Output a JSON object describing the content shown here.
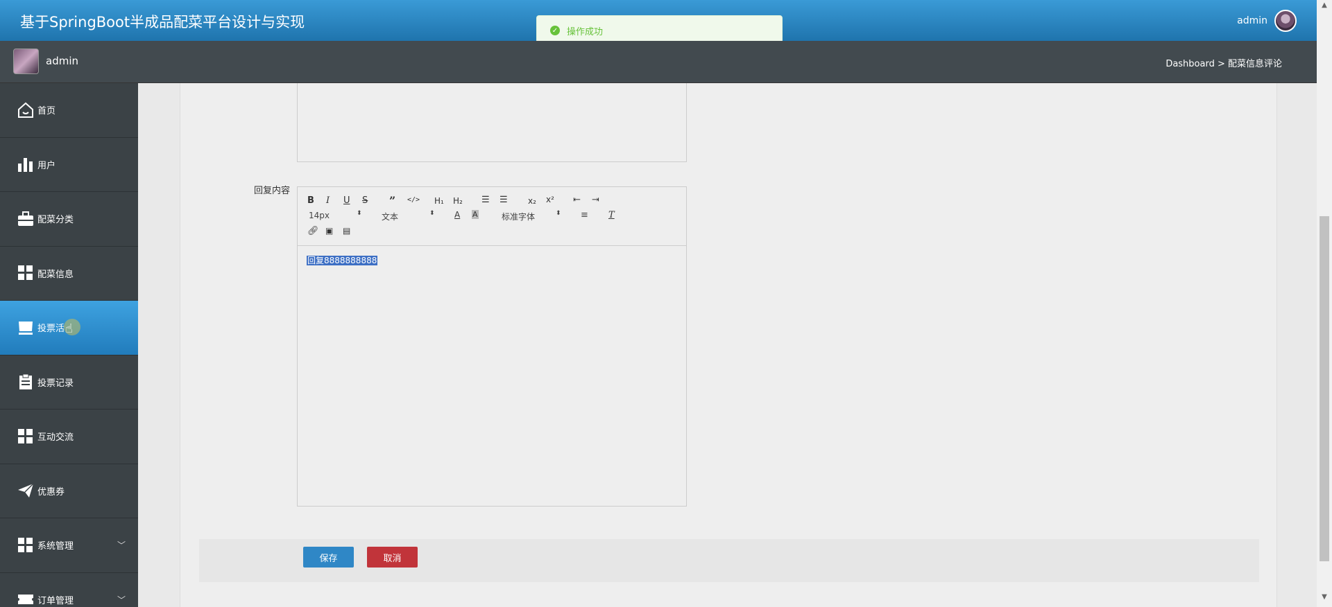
{
  "header": {
    "title": "基于SpringBoot半成品配菜平台设计与实现",
    "user": "admin"
  },
  "subheader": {
    "user": "admin",
    "breadcrumb": "Dashboard > 配菜信息评论"
  },
  "sidebar": {
    "items": [
      {
        "label": "首页",
        "icon": "home-icon"
      },
      {
        "label": "用户",
        "icon": "bar-chart-icon"
      },
      {
        "label": "配菜分类",
        "icon": "briefcase-icon"
      },
      {
        "label": "配菜信息",
        "icon": "grid-icon"
      },
      {
        "label": "投票活",
        "icon": "store-icon",
        "active": true
      },
      {
        "label": "投票记录",
        "icon": "clipboard-icon"
      },
      {
        "label": "互动交流",
        "icon": "grid-icon"
      },
      {
        "label": "优惠券",
        "icon": "paper-plane-icon"
      },
      {
        "label": "系统管理",
        "icon": "grid-icon",
        "expandable": true
      },
      {
        "label": "订单管理",
        "icon": "ticket-icon",
        "expandable": true
      }
    ]
  },
  "form": {
    "reply_label": "回复内容",
    "editor": {
      "font_size": "14px",
      "block_format": "文本",
      "font_family": "标准字体",
      "content": "回复8888888888"
    },
    "save_label": "保存",
    "cancel_label": "取消"
  },
  "toast": {
    "message": "操作成功",
    "color": "#67c23a"
  },
  "colors": {
    "header": "#2a86c4",
    "sidebar": "#3b4246",
    "active": "#3ea2e0",
    "save": "#2f87c6",
    "cancel": "#c1343a"
  }
}
